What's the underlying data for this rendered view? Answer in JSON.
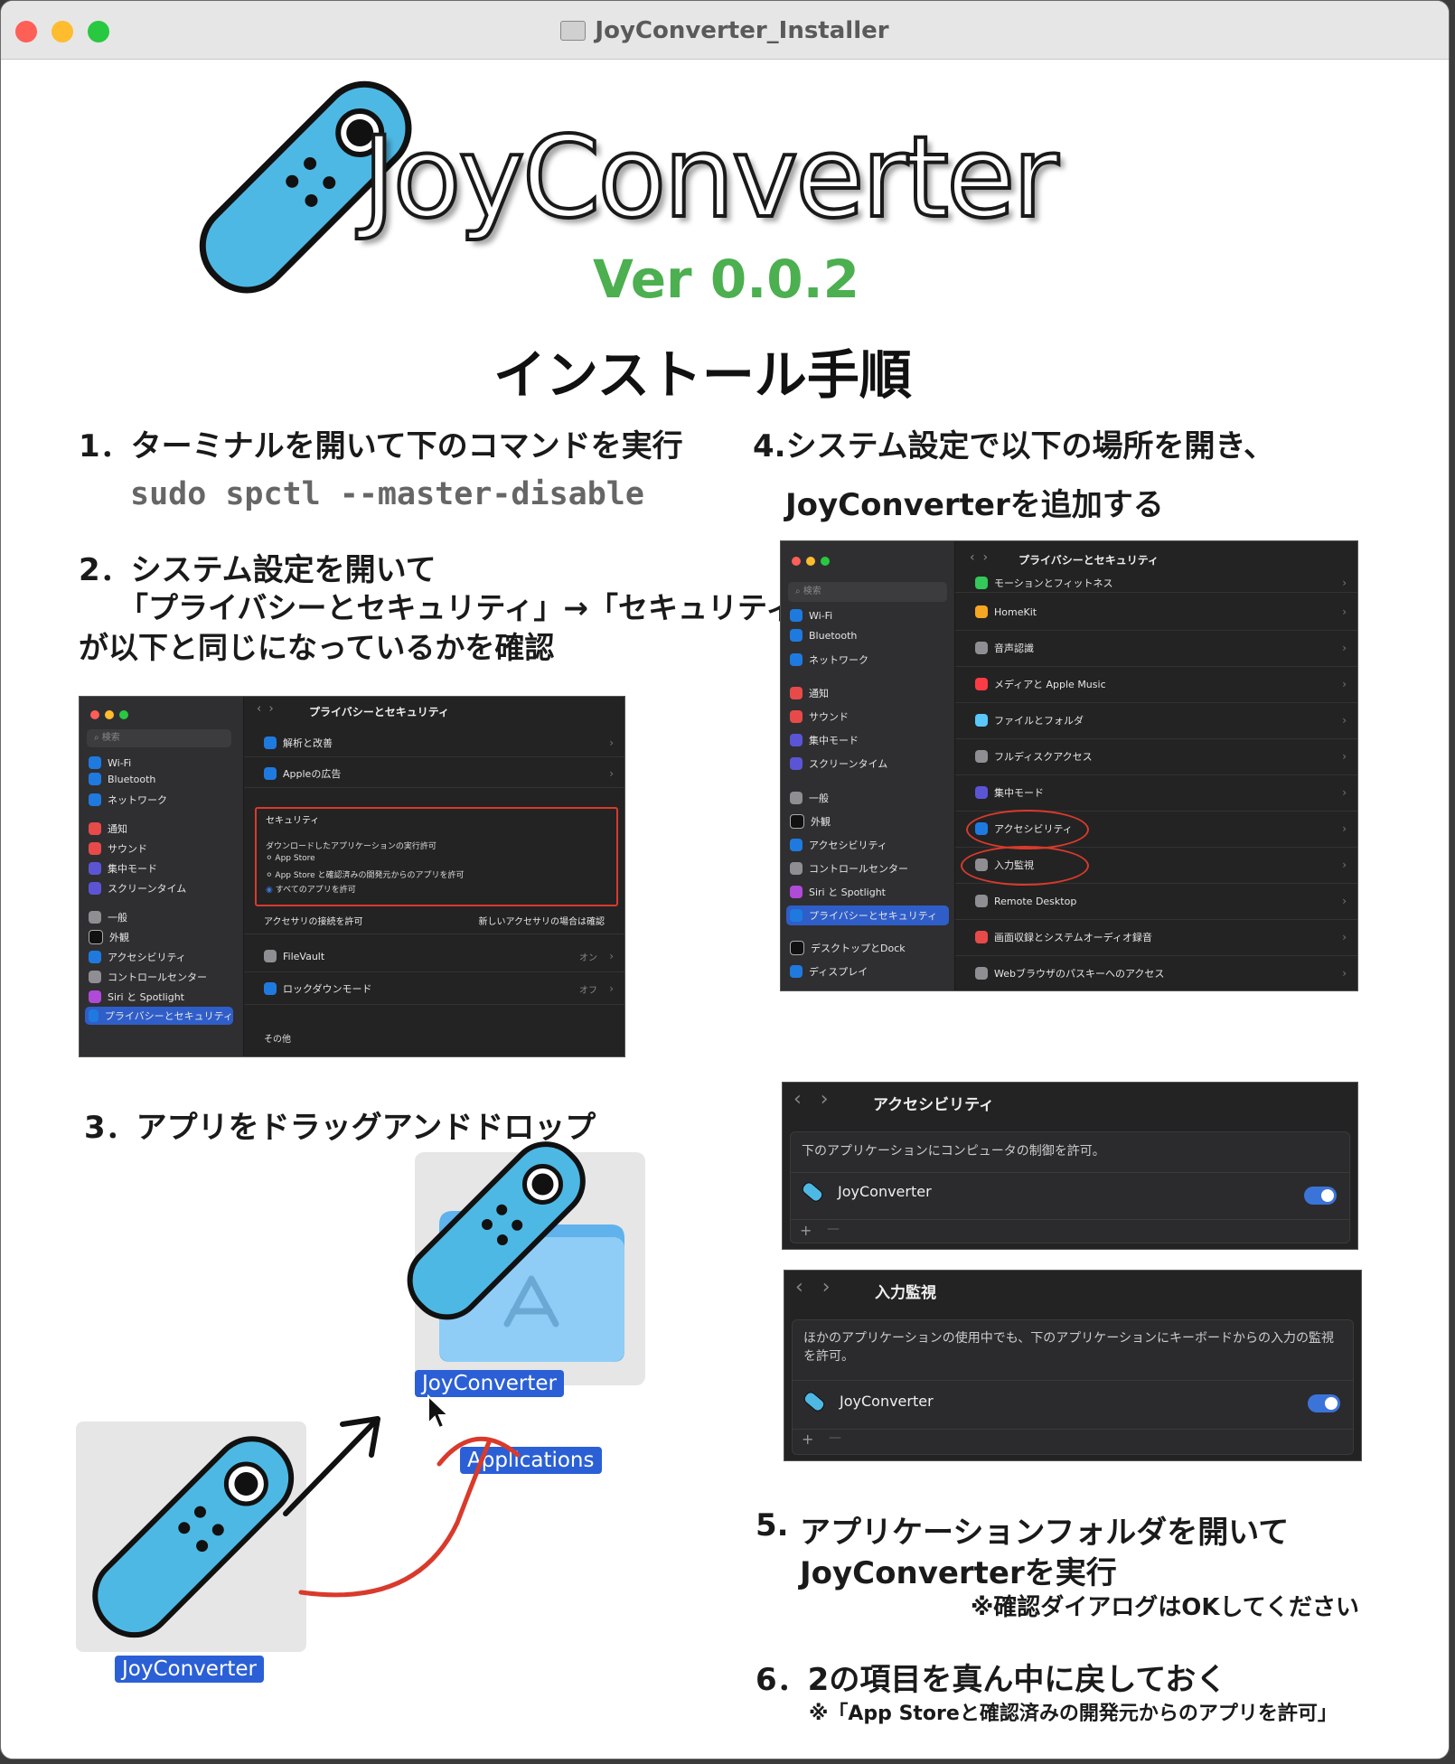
{
  "window": {
    "title": "JoyConverter_Installer"
  },
  "header": {
    "app_name": "JoyConverter",
    "version": "Ver 0.0.2",
    "heading": "インストール手順"
  },
  "steps": {
    "s1": "1．ターミナルを開いて下のコマンドを実行",
    "s1_cmd": "sudo spctl --master-disable",
    "s2_l1": "2．システム設定を開いて",
    "s2_l2": "「プライバシーとセキュリティ」→「セキュリティ」",
    "s2_l3": "が以下と同じになっているかを確認",
    "s3": "3．アプリをドラッグアンドドロップ",
    "s4_l1": "4.システム設定で以下の場所を開き、",
    "s4_l2": "JoyConverterを追加する",
    "s5_num": "5.",
    "s5_l1": "アプリケーションフォルダを開いて",
    "s5_l2": "JoyConverterを実行",
    "s5_note": "※確認ダイアログはOKしてください",
    "s6_l1": "6．2の項目を真ん中に戻しておく",
    "s6_note": "※「App Storeと確認済みの開発元からのアプリを許可」"
  },
  "shot_security": {
    "search": "検索",
    "sidebar": [
      "Wi-Fi",
      "Bluetooth",
      "ネットワーク",
      "通知",
      "サウンド",
      "集中モード",
      "スクリーンタイム",
      "一般",
      "外観",
      "アクセシビリティ",
      "コントロールセンター",
      "Siri と Spotlight",
      "プライバシーとセキュリティ"
    ],
    "title": "プライバシーとセキュリティ",
    "row_analytics": "解析と改善",
    "row_ads": "Appleの広告",
    "sec_header": "セキュリティ",
    "sec_desc": "ダウンロードしたアプリケーションの実行許可",
    "opt1": "App Store",
    "opt2": "App Store と確認済みの開発元からのアプリを許可",
    "opt3": "すべてのアプリを許可",
    "accessory_label": "アクセサリの接続を許可",
    "accessory_value": "新しいアクセサリの場合は確認",
    "filevault": "FileVault",
    "filevault_val": "オン",
    "lockdown": "ロックダウンモード",
    "lockdown_val": "オフ",
    "other": "その他"
  },
  "shot_privacy": {
    "search": "検索",
    "title": "プライバシーとセキュリティ",
    "sidebar": [
      "Wi-Fi",
      "Bluetooth",
      "ネットワーク",
      "通知",
      "サウンド",
      "集中モード",
      "スクリーンタイム",
      "一般",
      "外観",
      "アクセシビリティ",
      "コントロールセンター",
      "Siri と Spotlight",
      "プライバシーとセキュリティ",
      "デスクトップとDock",
      "ディスプレイ"
    ],
    "rows": [
      "モーションとフィットネス",
      "HomeKit",
      "音声認識",
      "メディアと Apple Music",
      "ファイルとフォルダ",
      "フルディスクアクセス",
      "集中モード",
      "アクセシビリティ",
      "入力監視",
      "Remote Desktop",
      "画面収録とシステムオーディオ録音",
      "Webブラウザのパスキーへのアクセス"
    ]
  },
  "shot_access": {
    "title": "アクセシビリティ",
    "desc": "下のアプリケーションにコンピュータの制御を許可。",
    "app": "JoyConverter",
    "plus": "+",
    "minus": "—"
  },
  "shot_input": {
    "title": "入力監視",
    "desc": "ほかのアプリケーションの使用中でも、下のアプリケーションにキーボードからの入力の監視を許可。",
    "app": "JoyConverter",
    "plus": "+",
    "minus": "—"
  },
  "dnd": {
    "app_label": "JoyConverter",
    "dragging_label": "JoyConverter",
    "folder_label": "Applications"
  },
  "colors": {
    "accent_green": "#4caf50",
    "joycon_blue": "#4eb8e4",
    "highlight_red": "#d93a2b",
    "select_blue": "#2b5fd6"
  }
}
